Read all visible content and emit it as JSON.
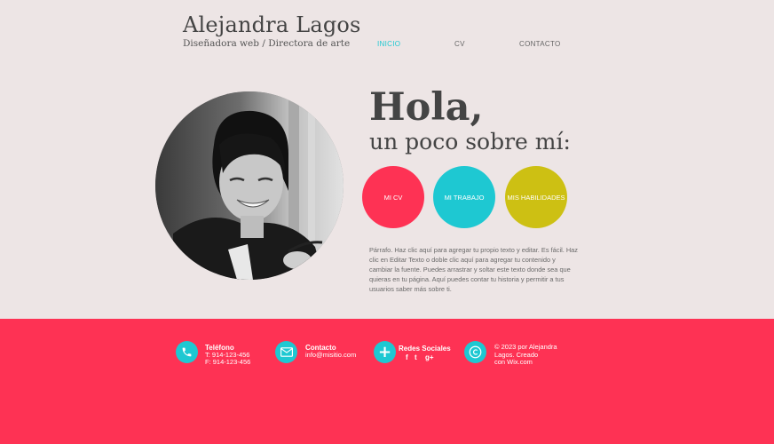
{
  "header": {
    "title": "Alejandra Lagos",
    "tagline": "Diseñadora web / Directora de arte"
  },
  "nav": {
    "items": [
      {
        "label": "INICIO",
        "active": true
      },
      {
        "label": "CV",
        "active": false
      },
      {
        "label": "CONTACTO",
        "active": false
      }
    ],
    "active_color": "#1ec8d2",
    "inactive_color": "#666666"
  },
  "hero": {
    "heading": "Hola,",
    "subheading": "un poco sobre mí:",
    "buttons": [
      {
        "label": "MI CV",
        "color": "#fe3254"
      },
      {
        "label": "MI TRABAJO",
        "color": "#1ec8d2"
      },
      {
        "label": "MIS HABILIDADES",
        "color": "#cdc013"
      }
    ],
    "paragraph": "Párrafo. Haz clic aquí para agregar tu propio texto y editar. Es fácil. Haz clic en Editar Texto o doble clic aquí para agregar tu contenido y cambiar la fuente. Puedes arrastrar y soltar este texto donde sea que quieras en tu página. Aquí puedes contar tu historia y permitir a tus usuarios saber más sobre ti."
  },
  "footer": {
    "background": "#fe3254",
    "icon_color": "#1ec8d2",
    "phone": {
      "icon": "phone-icon",
      "title": "Teléfono",
      "lines": [
        "T: 914-123-456",
        "F: 914-123-456"
      ]
    },
    "contact": {
      "icon": "envelope-icon",
      "title": "Contacto",
      "email": "info@misitio.com"
    },
    "social": {
      "icon": "plus-icon",
      "title": "Redes Sociales",
      "links": [
        "f",
        "t",
        "g+"
      ]
    },
    "copyright": {
      "icon": "copyright-icon",
      "lines": [
        "© 2023 por Alejandra",
        "Lagos. Creado",
        "con Wix.com"
      ]
    }
  }
}
